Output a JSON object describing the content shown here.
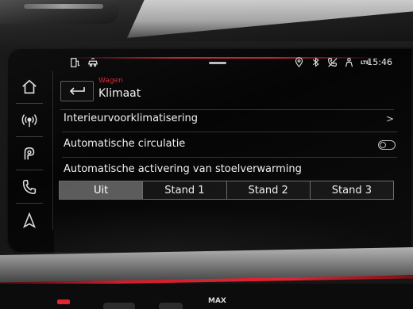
{
  "status_bar": {
    "time": "15:46",
    "network": "LTE",
    "left_icons": [
      "fuel-pump-icon",
      "car-sync-icon"
    ],
    "right_icons": [
      "location-pin-icon",
      "bluetooth-icon",
      "phone-muted-icon",
      "person-icon"
    ]
  },
  "sidebar": {
    "items": [
      {
        "name": "home-icon",
        "active": false
      },
      {
        "name": "radio-icon",
        "active": false
      },
      {
        "name": "music-icon",
        "active": false
      },
      {
        "name": "phone-icon",
        "active": false
      },
      {
        "name": "navigation-icon",
        "active": false
      }
    ]
  },
  "header": {
    "section": "Wagen",
    "title": "Klimaat"
  },
  "settings": {
    "preconditioning_label": "Interieurvoorklimatisering",
    "preconditioning_chevron": ">",
    "auto_circulation_label": "Automatische circulatie",
    "auto_circulation_on": false,
    "seat_heating_label": "Automatische activering van stoelverwarming",
    "seat_heating_options": [
      "Uit",
      "Stand 1",
      "Stand 2",
      "Stand 3"
    ],
    "seat_heating_selected": "Uit"
  },
  "console": {
    "max_label": "MAX"
  },
  "colors": {
    "accent_red": "#d9252e",
    "selected_segment": "#5b5b5b",
    "text": "#f1f1f1"
  }
}
